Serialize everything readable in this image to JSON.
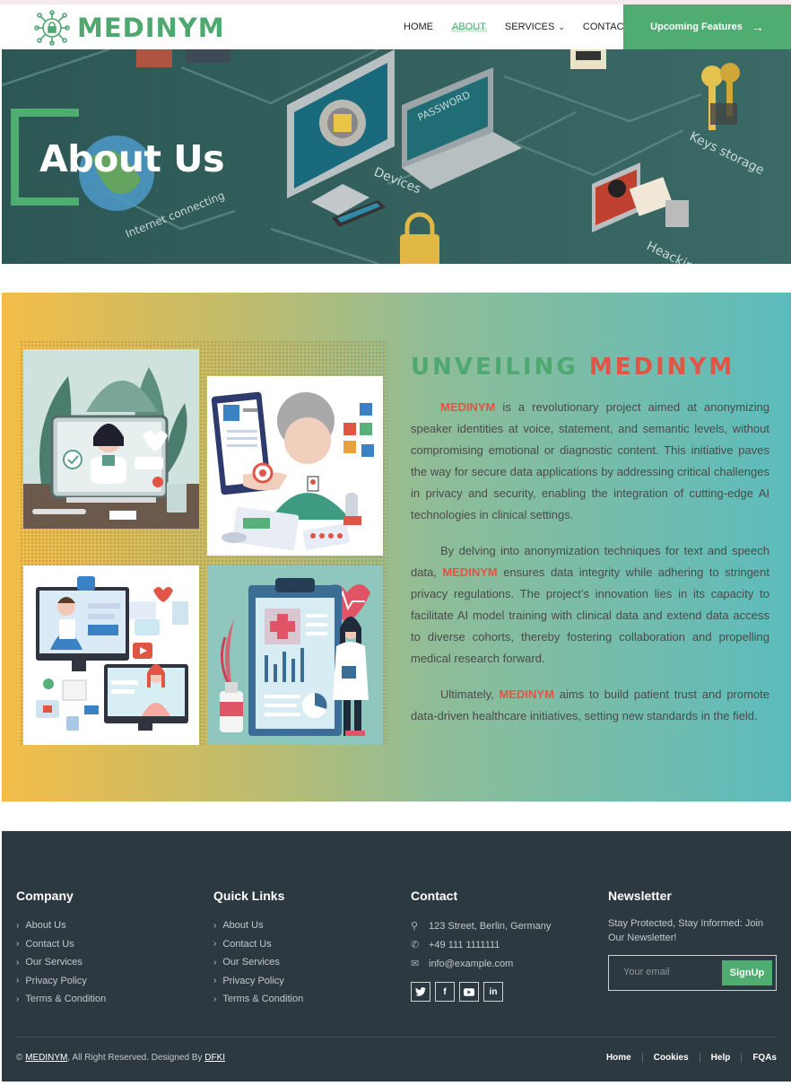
{
  "nav": {
    "brand": "MEDINYM",
    "items": [
      {
        "label": "HOME"
      },
      {
        "label": "ABOUT"
      },
      {
        "label": "SERVICES"
      },
      {
        "label": "CONTACT"
      }
    ],
    "cta_label": "Upcoming Features",
    "accent": "#4fad72"
  },
  "hero": {
    "title": "About Us"
  },
  "about": {
    "title_part1": "UNVEILING",
    "title_part2": "MEDINYM",
    "brand": "MEDINYM",
    "p1_rest": " is a revolutionary project aimed at anonymizing speaker identities at voice, statement, and semantic levels, without compromising emotional or diagnostic content. This initiative paves the way for secure data applications by addressing critical challenges in privacy and security, enabling the integration of cutting-edge AI technologies in clinical settings.",
    "p2_pre": "By delving into anonymization techniques for text and speech data, ",
    "p2_rest": " ensures data integrity while adhering to stringent privacy regulations. The project’s innovation lies in its capacity to facilitate AI model training with clinical data and extend data access to diverse cohorts, thereby fostering collaboration and propelling medical research forward.",
    "p3_pre": "Ultimately, ",
    "p3_rest": " aims to build patient trust and promote data-driven healthcare initiatives, setting new standards in the field.",
    "highlight_color": "#e05545"
  },
  "footer": {
    "company": {
      "heading": "Company",
      "links": [
        "About Us",
        "Contact Us",
        "Our Services",
        "Privacy Policy",
        "Terms & Condition"
      ]
    },
    "quick": {
      "heading": "Quick Links",
      "links": [
        "About Us",
        "Contact Us",
        "Our Services",
        "Privacy Policy",
        "Terms & Condition"
      ]
    },
    "contact": {
      "heading": "Contact",
      "address": "123 Street, Berlin, Germany",
      "phone": "+49 111 1111111",
      "email": "info@example.com",
      "socials": [
        "twitter-icon",
        "facebook-icon",
        "youtube-icon",
        "linkedin-icon"
      ]
    },
    "newsletter": {
      "heading": "Newsletter",
      "text": "Stay Protected, Stay Informed: Join Our Newsletter!",
      "placeholder": "Your email",
      "button": "SignUp"
    },
    "copyright_prefix": "©",
    "copyright_brand": "MEDINYM",
    "copyright_mid": ", All Right Reserved. Designed By",
    "copyright_designer": "DFKI",
    "bottom_links": [
      "Home",
      "Cookies",
      "Help",
      "FQAs"
    ]
  }
}
